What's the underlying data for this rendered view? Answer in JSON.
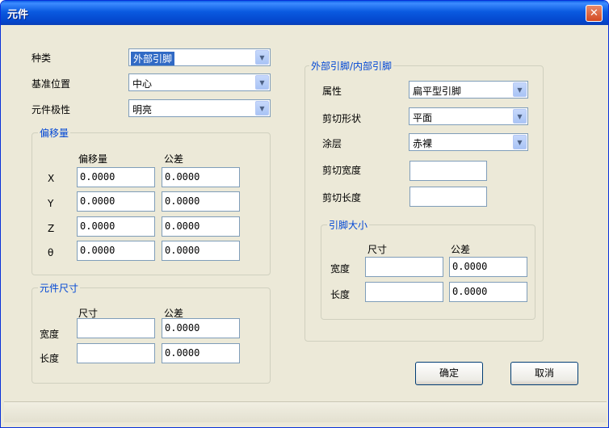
{
  "window": {
    "title": "元件",
    "close_icon": "close-icon"
  },
  "left": {
    "type_label": "种类",
    "type_value": "外部引脚",
    "ref_label": "基准位置",
    "ref_value": "中心",
    "polarity_label": "元件极性",
    "polarity_value": "明亮"
  },
  "offset": {
    "title": "偏移量",
    "col_offset": "偏移量",
    "col_tol": "公差",
    "rows": [
      {
        "label": "X",
        "offset": "0.0000",
        "tol": "0.0000"
      },
      {
        "label": "Y",
        "offset": "0.0000",
        "tol": "0.0000"
      },
      {
        "label": "Z",
        "offset": "0.0000",
        "tol": "0.0000"
      },
      {
        "label": "θ",
        "offset": "0.0000",
        "tol": "0.0000"
      }
    ]
  },
  "size": {
    "title": "元件尺寸",
    "col_size": "尺寸",
    "col_tol": "公差",
    "width_label": "宽度",
    "width_size": "",
    "width_tol": "0.0000",
    "length_label": "长度",
    "length_size": "",
    "length_tol": "0.0000"
  },
  "pin": {
    "title": "外部引脚/内部引脚",
    "attr_label": "属性",
    "attr_value": "扁平型引脚",
    "cut_shape_label": "剪切形状",
    "cut_shape_value": "平面",
    "coating_label": "涂层",
    "coating_value": "赤裸",
    "cut_width_label": "剪切宽度",
    "cut_width_value": "",
    "cut_length_label": "剪切长度",
    "cut_length_value": ""
  },
  "pin_size": {
    "title": "引脚大小",
    "col_size": "尺寸",
    "col_tol": "公差",
    "width_label": "宽度",
    "width_size": "",
    "width_tol": "0.0000",
    "length_label": "长度",
    "length_size": "",
    "length_tol": "0.0000"
  },
  "buttons": {
    "ok": "确定",
    "cancel": "取消"
  },
  "icons": {
    "dropdown": "chevron-down-icon"
  },
  "colors": {
    "title_bar": "#0a5ae0",
    "group_title": "#0046d5",
    "background": "#ece9d8",
    "selection": "#316ac5"
  }
}
